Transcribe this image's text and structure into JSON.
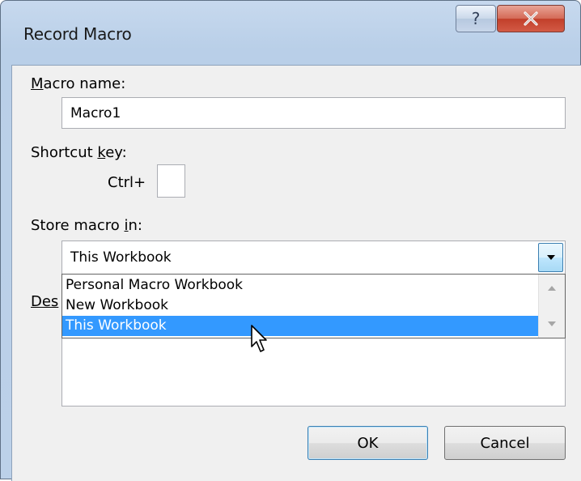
{
  "window": {
    "title": "Record Macro",
    "help_glyph": "?",
    "close_glyph": "X"
  },
  "macro_name": {
    "label_prefix": "",
    "label_accel": "M",
    "label_rest": "acro name:",
    "value": "Macro1"
  },
  "shortcut": {
    "label_prefix": "Shortcut ",
    "label_accel": "k",
    "label_rest": "ey:",
    "ctrl_label": "Ctrl+",
    "value": ""
  },
  "store": {
    "label_prefix": "Store macro ",
    "label_accel": "i",
    "label_rest": "n:",
    "selected": "This Workbook",
    "options": [
      "Personal Macro Workbook",
      "New Workbook",
      "This Workbook"
    ],
    "highlighted_index": 2
  },
  "description": {
    "label_visible": "Des",
    "value": ""
  },
  "buttons": {
    "ok": "OK",
    "cancel": "Cancel"
  },
  "icons": {
    "help": "help-icon",
    "close": "close-icon",
    "dropdown": "chevron-down-icon",
    "scroll_up": "scroll-up-arrow-icon",
    "scroll_down": "scroll-down-arrow-icon",
    "cursor": "mouse-pointer-icon"
  }
}
